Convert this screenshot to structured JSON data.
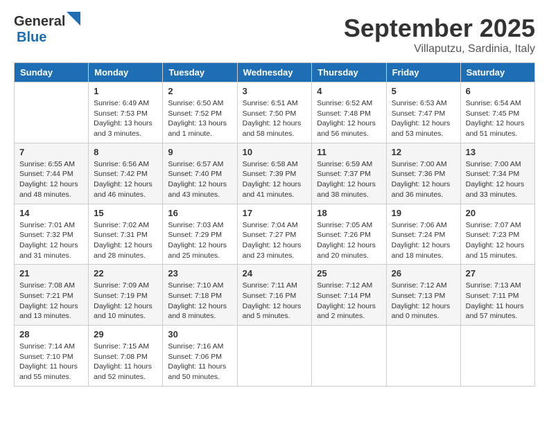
{
  "header": {
    "logo_general": "General",
    "logo_blue": "Blue",
    "month_title": "September 2025",
    "subtitle": "Villaputzu, Sardinia, Italy"
  },
  "days_of_week": [
    "Sunday",
    "Monday",
    "Tuesday",
    "Wednesday",
    "Thursday",
    "Friday",
    "Saturday"
  ],
  "weeks": [
    [
      {
        "day": "",
        "sunrise": "",
        "sunset": "",
        "daylight": ""
      },
      {
        "day": "1",
        "sunrise": "Sunrise: 6:49 AM",
        "sunset": "Sunset: 7:53 PM",
        "daylight": "Daylight: 13 hours and 3 minutes."
      },
      {
        "day": "2",
        "sunrise": "Sunrise: 6:50 AM",
        "sunset": "Sunset: 7:52 PM",
        "daylight": "Daylight: 13 hours and 1 minute."
      },
      {
        "day": "3",
        "sunrise": "Sunrise: 6:51 AM",
        "sunset": "Sunset: 7:50 PM",
        "daylight": "Daylight: 12 hours and 58 minutes."
      },
      {
        "day": "4",
        "sunrise": "Sunrise: 6:52 AM",
        "sunset": "Sunset: 7:48 PM",
        "daylight": "Daylight: 12 hours and 56 minutes."
      },
      {
        "day": "5",
        "sunrise": "Sunrise: 6:53 AM",
        "sunset": "Sunset: 7:47 PM",
        "daylight": "Daylight: 12 hours and 53 minutes."
      },
      {
        "day": "6",
        "sunrise": "Sunrise: 6:54 AM",
        "sunset": "Sunset: 7:45 PM",
        "daylight": "Daylight: 12 hours and 51 minutes."
      }
    ],
    [
      {
        "day": "7",
        "sunrise": "Sunrise: 6:55 AM",
        "sunset": "Sunset: 7:44 PM",
        "daylight": "Daylight: 12 hours and 48 minutes."
      },
      {
        "day": "8",
        "sunrise": "Sunrise: 6:56 AM",
        "sunset": "Sunset: 7:42 PM",
        "daylight": "Daylight: 12 hours and 46 minutes."
      },
      {
        "day": "9",
        "sunrise": "Sunrise: 6:57 AM",
        "sunset": "Sunset: 7:40 PM",
        "daylight": "Daylight: 12 hours and 43 minutes."
      },
      {
        "day": "10",
        "sunrise": "Sunrise: 6:58 AM",
        "sunset": "Sunset: 7:39 PM",
        "daylight": "Daylight: 12 hours and 41 minutes."
      },
      {
        "day": "11",
        "sunrise": "Sunrise: 6:59 AM",
        "sunset": "Sunset: 7:37 PM",
        "daylight": "Daylight: 12 hours and 38 minutes."
      },
      {
        "day": "12",
        "sunrise": "Sunrise: 7:00 AM",
        "sunset": "Sunset: 7:36 PM",
        "daylight": "Daylight: 12 hours and 36 minutes."
      },
      {
        "day": "13",
        "sunrise": "Sunrise: 7:00 AM",
        "sunset": "Sunset: 7:34 PM",
        "daylight": "Daylight: 12 hours and 33 minutes."
      }
    ],
    [
      {
        "day": "14",
        "sunrise": "Sunrise: 7:01 AM",
        "sunset": "Sunset: 7:32 PM",
        "daylight": "Daylight: 12 hours and 31 minutes."
      },
      {
        "day": "15",
        "sunrise": "Sunrise: 7:02 AM",
        "sunset": "Sunset: 7:31 PM",
        "daylight": "Daylight: 12 hours and 28 minutes."
      },
      {
        "day": "16",
        "sunrise": "Sunrise: 7:03 AM",
        "sunset": "Sunset: 7:29 PM",
        "daylight": "Daylight: 12 hours and 25 minutes."
      },
      {
        "day": "17",
        "sunrise": "Sunrise: 7:04 AM",
        "sunset": "Sunset: 7:27 PM",
        "daylight": "Daylight: 12 hours and 23 minutes."
      },
      {
        "day": "18",
        "sunrise": "Sunrise: 7:05 AM",
        "sunset": "Sunset: 7:26 PM",
        "daylight": "Daylight: 12 hours and 20 minutes."
      },
      {
        "day": "19",
        "sunrise": "Sunrise: 7:06 AM",
        "sunset": "Sunset: 7:24 PM",
        "daylight": "Daylight: 12 hours and 18 minutes."
      },
      {
        "day": "20",
        "sunrise": "Sunrise: 7:07 AM",
        "sunset": "Sunset: 7:23 PM",
        "daylight": "Daylight: 12 hours and 15 minutes."
      }
    ],
    [
      {
        "day": "21",
        "sunrise": "Sunrise: 7:08 AM",
        "sunset": "Sunset: 7:21 PM",
        "daylight": "Daylight: 12 hours and 13 minutes."
      },
      {
        "day": "22",
        "sunrise": "Sunrise: 7:09 AM",
        "sunset": "Sunset: 7:19 PM",
        "daylight": "Daylight: 12 hours and 10 minutes."
      },
      {
        "day": "23",
        "sunrise": "Sunrise: 7:10 AM",
        "sunset": "Sunset: 7:18 PM",
        "daylight": "Daylight: 12 hours and 8 minutes."
      },
      {
        "day": "24",
        "sunrise": "Sunrise: 7:11 AM",
        "sunset": "Sunset: 7:16 PM",
        "daylight": "Daylight: 12 hours and 5 minutes."
      },
      {
        "day": "25",
        "sunrise": "Sunrise: 7:12 AM",
        "sunset": "Sunset: 7:14 PM",
        "daylight": "Daylight: 12 hours and 2 minutes."
      },
      {
        "day": "26",
        "sunrise": "Sunrise: 7:12 AM",
        "sunset": "Sunset: 7:13 PM",
        "daylight": "Daylight: 12 hours and 0 minutes."
      },
      {
        "day": "27",
        "sunrise": "Sunrise: 7:13 AM",
        "sunset": "Sunset: 7:11 PM",
        "daylight": "Daylight: 11 hours and 57 minutes."
      }
    ],
    [
      {
        "day": "28",
        "sunrise": "Sunrise: 7:14 AM",
        "sunset": "Sunset: 7:10 PM",
        "daylight": "Daylight: 11 hours and 55 minutes."
      },
      {
        "day": "29",
        "sunrise": "Sunrise: 7:15 AM",
        "sunset": "Sunset: 7:08 PM",
        "daylight": "Daylight: 11 hours and 52 minutes."
      },
      {
        "day": "30",
        "sunrise": "Sunrise: 7:16 AM",
        "sunset": "Sunset: 7:06 PM",
        "daylight": "Daylight: 11 hours and 50 minutes."
      },
      {
        "day": "",
        "sunrise": "",
        "sunset": "",
        "daylight": ""
      },
      {
        "day": "",
        "sunrise": "",
        "sunset": "",
        "daylight": ""
      },
      {
        "day": "",
        "sunrise": "",
        "sunset": "",
        "daylight": ""
      },
      {
        "day": "",
        "sunrise": "",
        "sunset": "",
        "daylight": ""
      }
    ]
  ]
}
